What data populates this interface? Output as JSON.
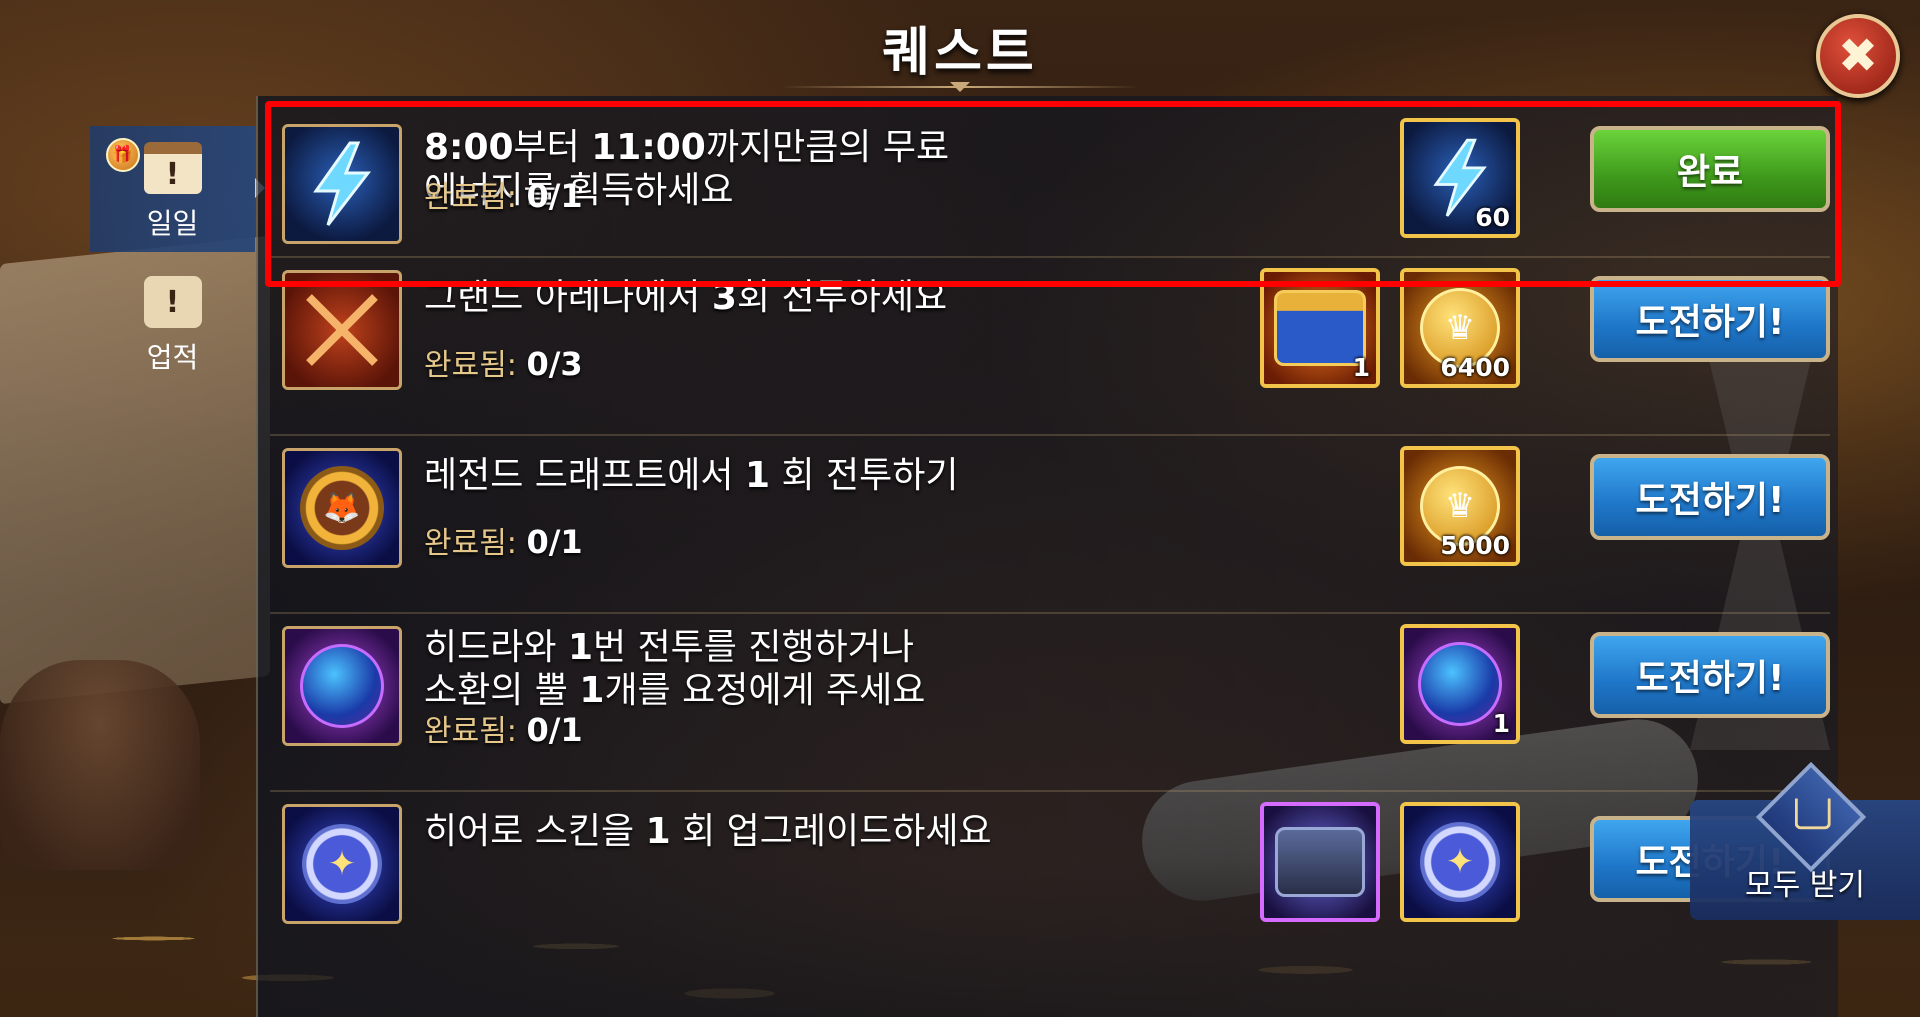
{
  "header": {
    "title": "퀘스트"
  },
  "sidebar": {
    "tabs": [
      {
        "label": "일일",
        "icon": "calendar-icon",
        "active": true,
        "badge_icon": "gift-icon"
      },
      {
        "label": "업적",
        "icon": "scroll-icon",
        "active": false
      }
    ]
  },
  "quests": [
    {
      "title_line1_num1": "8:00",
      "title_line1_mid": "부터 ",
      "title_line1_num2": "11:00",
      "title_line1_end": "까지만큼의 무료",
      "title_line2": "에너지를 획득하세요",
      "progress_label": "완료됨:",
      "progress_value": "0/1",
      "icon": "energy-bolt-icon",
      "rewards": [
        {
          "icon": "energy-bolt-icon",
          "count": "60"
        }
      ],
      "button_label": "완료",
      "button_color": "#4cae24"
    },
    {
      "title_pre": "그랜드 아레나에서 ",
      "title_num": "3",
      "title_post": "회 전투하세요",
      "progress_label": "완료됨:",
      "progress_value": "0/3",
      "icon": "crossed-swords-icon",
      "rewards": [
        {
          "icon": "treasure-chest-icon",
          "count": "1"
        },
        {
          "icon": "gold-coin-icon",
          "count": "6400"
        }
      ],
      "button_label": "도전하기!",
      "button_color": "#2a86d8"
    },
    {
      "title_pre": "레전드 드래프트에서 ",
      "title_num": "1",
      "title_post": " 회 전투하기",
      "progress_label": "완료됨:",
      "progress_value": "0/1",
      "icon": "fox-medal-icon",
      "rewards": [
        {
          "icon": "gold-coin-icon",
          "count": "5000"
        }
      ],
      "button_label": "도전하기!",
      "button_color": "#2a86d8"
    },
    {
      "title_line1_pre": "히드라와 ",
      "title_line1_num": "1",
      "title_line1_post": "번 전투를 진행하거나",
      "title_line2_pre": "소환의 뿔 ",
      "title_line2_num": "1",
      "title_line2_post": "개를 요정에게 주세요",
      "progress_label": "완료됨:",
      "progress_value": "0/1",
      "icon": "summoning-orb-icon",
      "rewards": [
        {
          "icon": "summoning-orb-icon",
          "count": "1"
        }
      ],
      "button_label": "도전하기!",
      "button_color": "#2a86d8"
    },
    {
      "title_pre": "히어로 스킨을 ",
      "title_num": "1",
      "title_post": " 회 업그레이드하세요",
      "icon": "skin-stone-icon",
      "rewards": [
        {
          "icon": "skin-box-icon"
        },
        {
          "icon": "skin-stone-icon"
        }
      ],
      "button_label": "도전하기!",
      "button_color": "#2a86d8"
    }
  ],
  "collect_all": {
    "label": "모두 받기",
    "icon": "collect-all-icon"
  },
  "highlight_color": "#ff0000"
}
